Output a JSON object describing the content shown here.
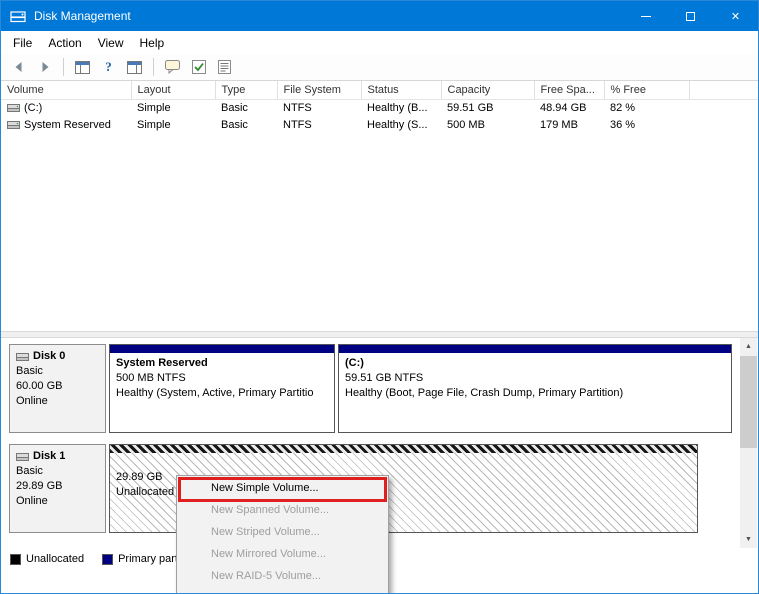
{
  "window": {
    "title": "Disk Management",
    "controls": {
      "minimize": "minimize",
      "maximize": "maximize",
      "close": "close"
    }
  },
  "menu": {
    "items": [
      "File",
      "Action",
      "View",
      "Help"
    ]
  },
  "toolbar": {
    "icons": [
      "back-icon",
      "forward-icon",
      "console-tree-icon",
      "help-icon",
      "action-pane-icon",
      "tooltip-icon",
      "checkmark-icon",
      "export-list-icon"
    ]
  },
  "volume_table": {
    "columns": [
      "Volume",
      "Layout",
      "Type",
      "File System",
      "Status",
      "Capacity",
      "Free Spa...",
      "% Free",
      ""
    ],
    "rows": [
      {
        "volume": "(C:)",
        "layout": "Simple",
        "type": "Basic",
        "file_system": "NTFS",
        "status": "Healthy (B...",
        "capacity": "59.51 GB",
        "free_space": "48.94 GB",
        "percent_free": "82 %"
      },
      {
        "volume": "System Reserved",
        "layout": "Simple",
        "type": "Basic",
        "file_system": "NTFS",
        "status": "Healthy (S...",
        "capacity": "500 MB",
        "free_space": "179 MB",
        "percent_free": "36 %"
      }
    ]
  },
  "disks": [
    {
      "name": "Disk 0",
      "type": "Basic",
      "size": "60.00 GB",
      "status": "Online",
      "partitions": [
        {
          "title": "System Reserved",
          "size_line": "500 MB NTFS",
          "status_line": "Healthy (System, Active, Primary Partitio"
        },
        {
          "title": "(C:)",
          "size_line": "59.51 GB NTFS",
          "status_line": "Healthy (Boot, Page File, Crash Dump, Primary Partition)"
        }
      ]
    },
    {
      "name": "Disk 1",
      "type": "Basic",
      "size": "29.89 GB",
      "status": "Online",
      "partitions": [
        {
          "title": "",
          "size_line": "29.89 GB",
          "status_line": "Unallocated"
        }
      ]
    }
  ],
  "context_menu": {
    "items": [
      {
        "label": "New Simple Volume...",
        "enabled": true,
        "highlighted": true
      },
      {
        "label": "New Spanned Volume...",
        "enabled": false
      },
      {
        "label": "New Striped Volume...",
        "enabled": false
      },
      {
        "label": "New Mirrored Volume...",
        "enabled": false
      },
      {
        "label": "New RAID-5 Volume...",
        "enabled": false
      }
    ]
  },
  "legend": {
    "items": [
      {
        "label": "Unallocated",
        "color": "#000000"
      },
      {
        "label": "Primary part",
        "color": "#000080"
      }
    ]
  },
  "colors": {
    "titlebar": "#0078d7",
    "primary_partition_band": "#000082",
    "unallocated": "#000000",
    "highlight_red": "#e0201f"
  }
}
